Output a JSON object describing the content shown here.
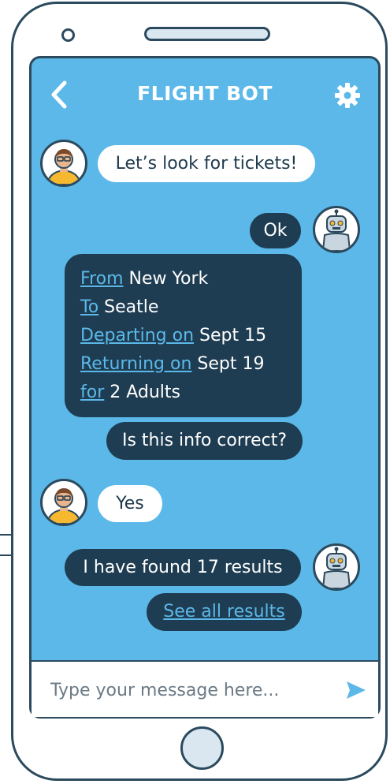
{
  "header": {
    "title": "FLIGHT BOT",
    "back_icon": "chevron-left-icon",
    "settings_icon": "gear-icon"
  },
  "messages": {
    "m1": "Let’s look for tickets!",
    "m2": "Ok",
    "info": {
      "from_label": "From",
      "from_value": "New York",
      "to_label": "To",
      "to_value": "Seatle",
      "depart_label": "Departing on",
      "depart_value": "Sept 15",
      "return_label": "Returning on",
      "return_value": "Sept 19",
      "for_label": "for",
      "for_value": "2 Adults"
    },
    "m4": "Is this info correct?",
    "m5": "Yes",
    "m6": "I have found 17 results",
    "m7": "See all results"
  },
  "input": {
    "placeholder": "Type your message here...",
    "value": ""
  },
  "colors": {
    "screen": "#5bb8e8",
    "bot_bubble": "#1f3d52",
    "user_bubble": "#ffffff",
    "link": "#5bb8e8",
    "outline": "#2c4a5e"
  }
}
